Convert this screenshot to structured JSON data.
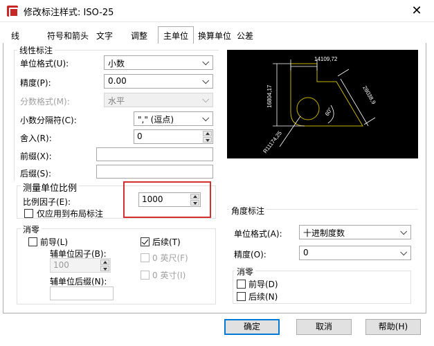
{
  "window": {
    "title": "修改标注样式: ISO-25",
    "close_glyph": "✕"
  },
  "tabs": [
    {
      "label": "线"
    },
    {
      "label": "符号和箭头"
    },
    {
      "label": "文字"
    },
    {
      "label": "调整"
    },
    {
      "label": "主单位",
      "active": true
    },
    {
      "label": "换算单位"
    },
    {
      "label": "公差"
    }
  ],
  "linear": {
    "group_title": "线性标注",
    "unit_format_label": "单位格式(U):",
    "unit_format_value": "小数",
    "precision_label": "精度(P):",
    "precision_value": "0.00",
    "fraction_format_label": "分数格式(M):",
    "fraction_format_value": "水平",
    "decimal_sep_label": "小数分隔符(C):",
    "decimal_sep_value": "\",\" (逗点)",
    "round_off_label": "舍入(R):",
    "round_off_value": "0",
    "prefix_label": "前缀(X):",
    "suffix_label": "后缀(S):"
  },
  "measurement_scale": {
    "group_title": "测量单位比例",
    "scale_factor_label": "比例因子(E):",
    "scale_factor_value": "1000",
    "apply_layout_label": "仅应用到布局标注"
  },
  "zero_suppression": {
    "group_title": "消零",
    "leading_label": "前导(L)",
    "sub_units_factor_label": "辅单位因子(B):",
    "sub_units_factor_value": "100",
    "sub_units_suffix_label": "辅单位后缀(N):",
    "trailing_label": "后续(T)",
    "feet_label": "0 英尺(F)",
    "inches_label": "0 英寸(I)"
  },
  "preview": {
    "dim_top": "14109,72",
    "dim_left": "16804,17",
    "dim_right": "28038,9",
    "dim_angle": "60°",
    "dim_radius": "R11174,25",
    "line_color": "#c8b400",
    "dim_color": "#ffffff"
  },
  "angular": {
    "group_title": "角度标注",
    "unit_format_label": "单位格式(A):",
    "unit_format_value": "十进制度数",
    "precision_label": "精度(O):",
    "precision_value": "0",
    "zero_group_title": "消零",
    "leading_label": "前导(D)",
    "trailing_label": "后续(N)"
  },
  "buttons": {
    "ok": "确定",
    "cancel": "取消",
    "help": "帮助(H)"
  },
  "colors": {
    "highlight_border": "#d32f2f",
    "default_button_border": "#0078d7"
  }
}
